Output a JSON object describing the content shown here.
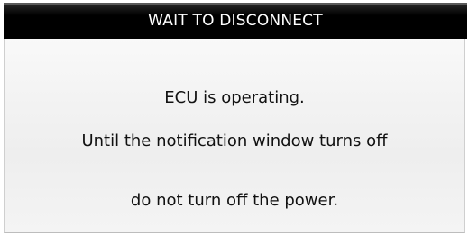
{
  "dialog": {
    "title": "WAIT TO DISCONNECT",
    "messages": [
      "ECU is operating.",
      "Until the notification window turns off",
      "do not turn off the power."
    ]
  },
  "colors": {
    "title_bar_bg": "#000000",
    "title_text": "#ffffff",
    "body_bg": "#f2f2f2",
    "message_text": "#111111"
  }
}
